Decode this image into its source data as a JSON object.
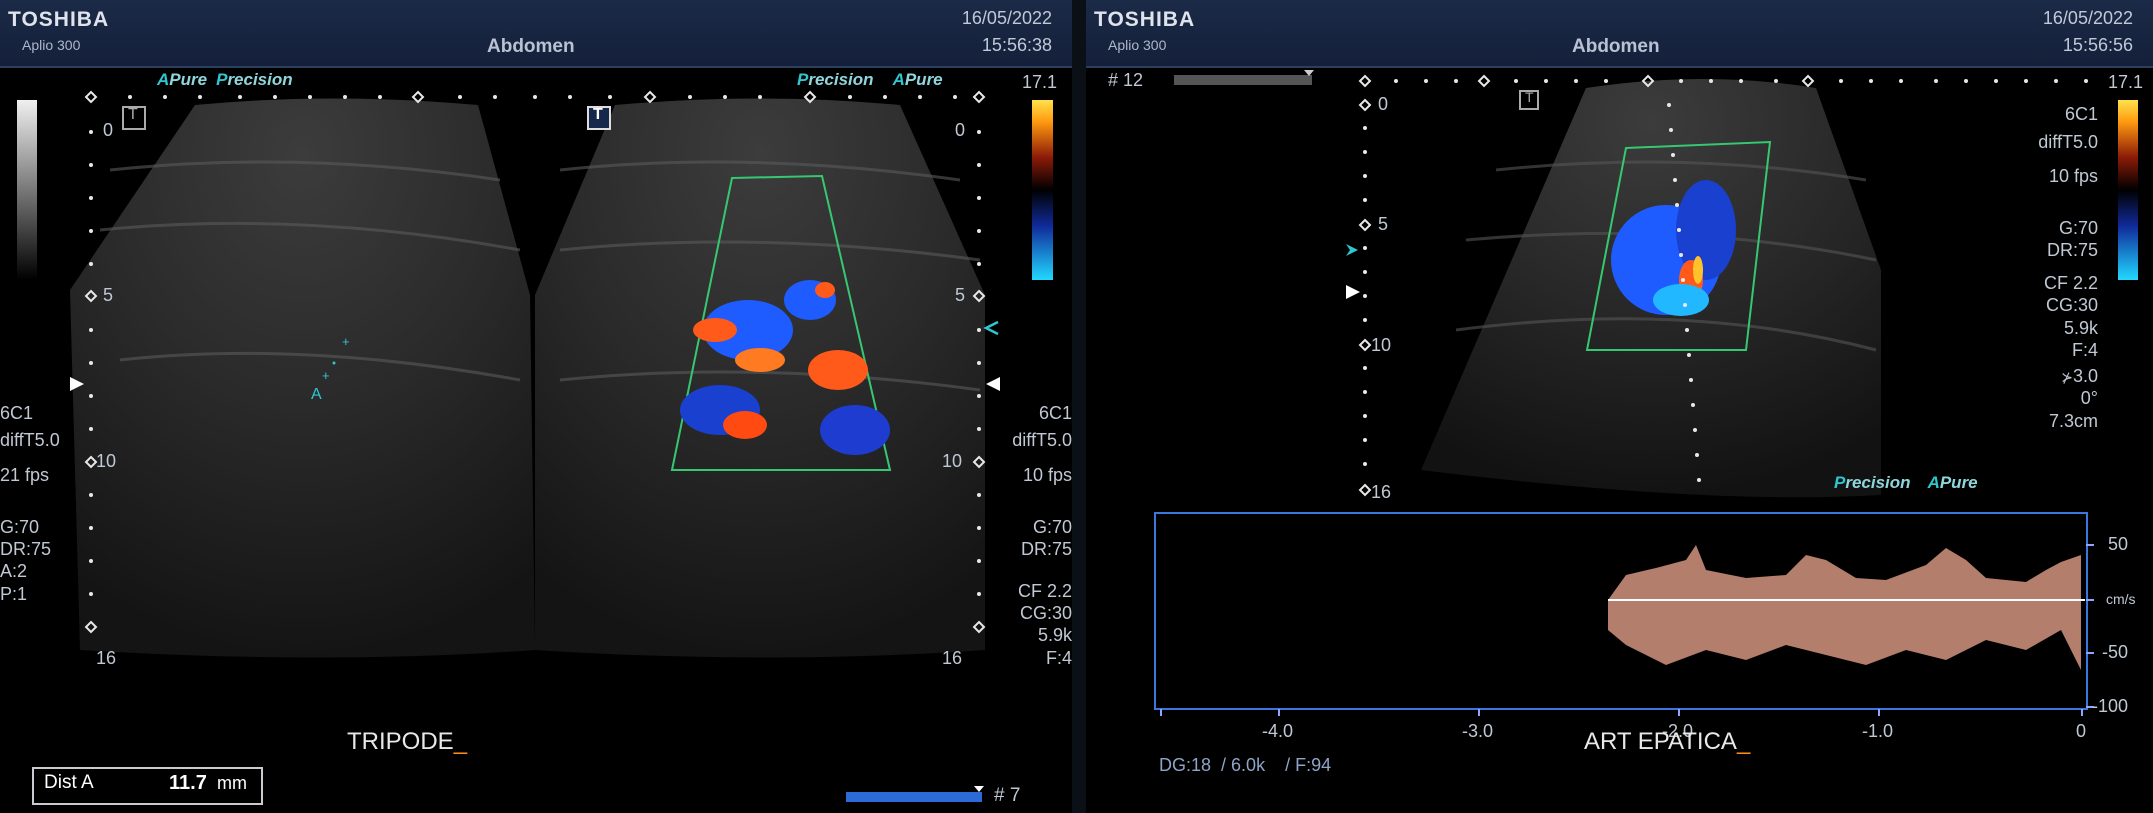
{
  "left": {
    "brand": "TOSHIBA",
    "model": "Aplio 300",
    "preset": "Abdomen",
    "date": "16/05/2022",
    "time": "15:56:38",
    "logo_a": "A",
    "logo_pure": "Pure",
    "logo_p": "P",
    "logo_recision": "recision",
    "color_scale_max": "17.1",
    "depth_ticks_left": [
      "0",
      "5",
      "10",
      "16"
    ],
    "depth_ticks_right": [
      "0",
      "5",
      "10",
      "16"
    ],
    "params_left": [
      "6C1",
      "diffT5.0",
      "21 fps",
      "G:70",
      "DR:75",
      "A:2",
      "P:1"
    ],
    "params_right": [
      "6C1",
      "diffT5.0",
      "10 fps",
      "G:70",
      "DR:75",
      "CF 2.2",
      "CG:30",
      "5.9k",
      "F:4"
    ],
    "annotation": "TRIPODE",
    "cursor": "_",
    "caliper_label": "A",
    "measure_label": "Dist A",
    "measure_value": "11.7",
    "measure_unit": "mm",
    "frame_marker": "# 7",
    "t_icon": "T"
  },
  "right": {
    "brand": "TOSHIBA",
    "model": "Aplio 300",
    "preset": "Abdomen",
    "date": "16/05/2022",
    "time": "15:56:56",
    "frame_marker": "# 12",
    "color_scale_max": "17.1",
    "depth_ticks": [
      "0",
      "5",
      "10",
      "16"
    ],
    "params": [
      "6C1",
      "diffT5.0",
      "10 fps",
      "G:70",
      "DR:75",
      "CF 2.2",
      "CG:30",
      "5.9k",
      "F:4",
      "3.0",
      "0°",
      "7.3cm"
    ],
    "spectral_y_ticks": [
      "50",
      "cm/s",
      "-50",
      "-100"
    ],
    "spectral_x_ticks": [
      "-4.0",
      "-3.0",
      "-2.0",
      "-1.0",
      "0"
    ],
    "doppler_settings": [
      "DG:18",
      "/ 6.0k",
      "/ F:94"
    ],
    "annotation": "ART EPATICA",
    "cursor": "_",
    "t_icon": "T"
  },
  "colors": {
    "accent_cyan": "#2fc6cf",
    "color_box_green": "#36c870",
    "spectral_frame": "#3a78e0",
    "doppler_flow_red": "#ff5a1a",
    "doppler_flow_blue": "#1f5cff"
  }
}
